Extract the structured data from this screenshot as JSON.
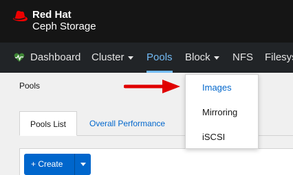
{
  "brand": {
    "line1": "Red Hat",
    "line2": "Ceph Storage",
    "logo_icon": "redhat-fedora-icon",
    "logo_color": "#ee0000"
  },
  "navbar": {
    "items": [
      {
        "label": "Dashboard",
        "icon": "heartbeat-icon"
      },
      {
        "label": "Cluster",
        "has_caret": true
      },
      {
        "label": "Pools",
        "active": true
      },
      {
        "label": "Block",
        "has_caret": true
      },
      {
        "label": "NFS"
      },
      {
        "label": "Filesys"
      }
    ]
  },
  "breadcrumb": "Pools",
  "tabs": [
    {
      "label": "Pools List",
      "active": true
    },
    {
      "label": "Overall Performance",
      "active": false
    }
  ],
  "toolbar": {
    "create_label": "Create",
    "create_icon": "plus-icon"
  },
  "block_menu": {
    "items": [
      {
        "label": "Images",
        "selected": true
      },
      {
        "label": "Mirroring"
      },
      {
        "label": "iSCSI"
      }
    ]
  },
  "colors": {
    "accent": "#73bcf7",
    "primary": "#0066cc",
    "annotation_arrow": "#e00000"
  }
}
